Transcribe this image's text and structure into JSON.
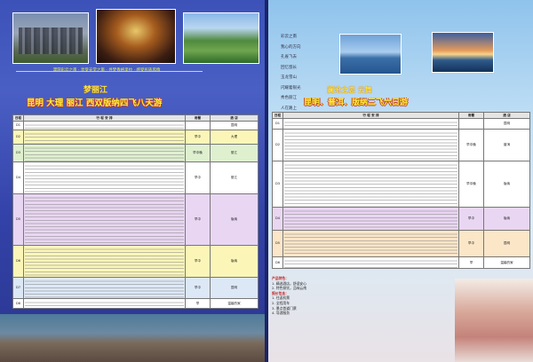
{
  "left": {
    "slogan": "漫游彩云之南 · 享受天堂之旅 · 寻梦香格里拉 · 感受民族风情",
    "subtitle": "梦丽江",
    "title": "昆明 大理 丽江 西双版纳四飞八天游",
    "table": {
      "headers": [
        "日程",
        "行 程 安 排",
        "用餐",
        "酒 店"
      ],
      "rows": [
        {
          "day": "D1",
          "meal": "",
          "hotel": "昆明"
        },
        {
          "day": "D2",
          "meal": "早中",
          "hotel": "大理"
        },
        {
          "day": "D3",
          "meal": "早中晚",
          "hotel": "丽江"
        },
        {
          "day": "D4",
          "meal": "早中",
          "hotel": "丽江"
        },
        {
          "day": "D5",
          "meal": "早中",
          "hotel": "版纳"
        },
        {
          "day": "D6",
          "meal": "早中",
          "hotel": "版纳"
        },
        {
          "day": "D7",
          "meal": "早中",
          "hotel": "昆明"
        },
        {
          "day": "D8",
          "meal": "早",
          "hotel": "温馨的家"
        }
      ]
    }
  },
  "right": {
    "poem": [
      "彩云之南",
      "我心的方向",
      "孔雀飞去",
      "回忆悠长",
      "玉龙雪山",
      "闪耀着银光",
      "秀色丽江",
      "人在路上"
    ],
    "subtitle": "澜沧之恋 云舞",
    "title": "昆明、普洱、版纳三飞六日游",
    "table": {
      "headers": [
        "日程",
        "行 程 安 排",
        "用餐",
        "酒 店"
      ],
      "rows": [
        {
          "day": "D1",
          "meal": "",
          "hotel": "昆明"
        },
        {
          "day": "D2",
          "meal": "早中晚",
          "hotel": "普洱"
        },
        {
          "day": "D3",
          "meal": "早中晚",
          "hotel": "版纳"
        },
        {
          "day": "D4",
          "meal": "早中",
          "hotel": "版纳"
        },
        {
          "day": "D5",
          "meal": "早中",
          "hotel": "昆明"
        },
        {
          "day": "D6",
          "meal": "早",
          "hotel": "温馨的家"
        }
      ]
    },
    "notes": [
      "产品特色：",
      "1. 精选酒店，舒适安心",
      "2. 特色餐饮，品味云南",
      "报价包含：",
      "1. 往返机票",
      "2. 全程用车",
      "3. 景点首道门票",
      "4. 导游服务"
    ]
  }
}
